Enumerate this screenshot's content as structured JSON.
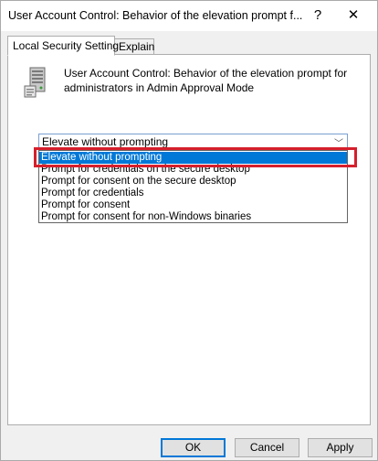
{
  "window": {
    "title": "User Account Control: Behavior of the elevation prompt f...",
    "help_glyph": "?",
    "close_glyph": "✕"
  },
  "tabs": [
    {
      "label": "Local Security Setting",
      "active": true
    },
    {
      "label": "Explain",
      "active": false
    }
  ],
  "policy": {
    "icon": "server-policy-icon",
    "title": "User Account Control: Behavior of the elevation prompt for administrators in Admin Approval Mode"
  },
  "combo": {
    "selected": "Elevate without prompting",
    "arrow_glyph": "﹀"
  },
  "dropdown": {
    "options": [
      "Elevate without prompting",
      "Prompt for credentials on the secure desktop",
      "Prompt for consent on the secure desktop",
      "Prompt for credentials",
      "Prompt for consent",
      "Prompt for consent for non-Windows binaries"
    ],
    "highlighted_index": 0
  },
  "buttons": {
    "ok": "OK",
    "cancel": "Cancel",
    "apply": "Apply"
  },
  "colors": {
    "selection": "#0078d7",
    "annotation_box": "#d61f2c"
  }
}
